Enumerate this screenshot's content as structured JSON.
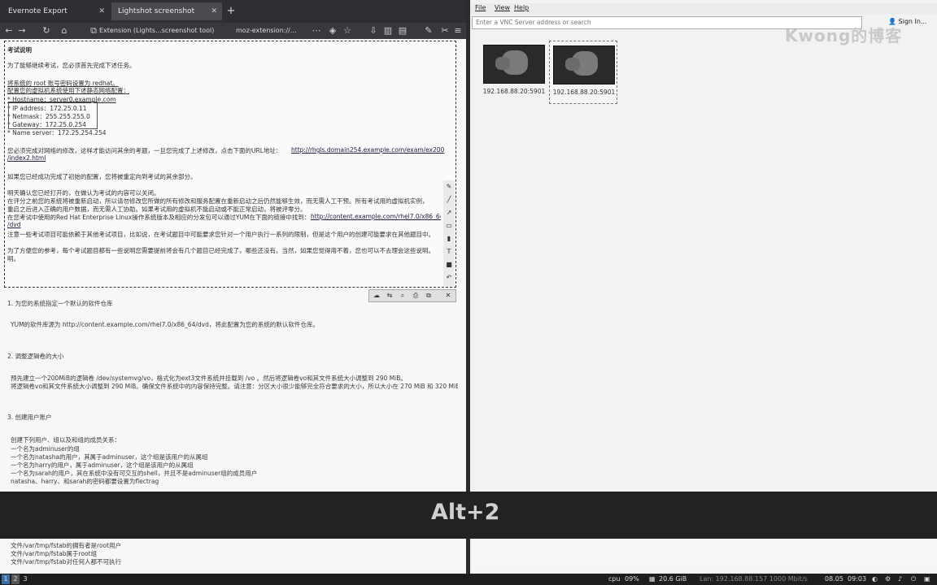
{
  "browser": {
    "tabs": [
      {
        "label": "Evernote Export",
        "active": false
      },
      {
        "label": "Lightshot screenshot",
        "active": true
      }
    ],
    "toolbar": {
      "extension_url": "Extension (Lights...screenshot tool)",
      "moz_url": "moz-extension://..."
    }
  },
  "screenshot": {
    "lines": [
      "考试说明",
      "为了能够继续考试，您必须首先完成下述任务。",
      "将系统的 root 账号密码设置为 redhat。",
      "配置您的虚拟机系统使用下述静态网络配置：",
      "* Hostname：server0.example.com",
      "* IP address：172.25.0.11",
      "* Netmask：255.255.255.0",
      "* Gateway：172.25.0.254",
      "* Name server：172.25.254.254",
      "您必须完成对网络的修改，这样才能访问其余的考题，一旦您完成了上述修改，点击下面的URL地址：",
      "http://rhgls.domain254.example.com/exam/ex200",
      "/index2.html",
      "如果您已经成功完成了初始的配置，您将被重定向到考试的其余部分。",
      "明天确认您已经打开的，在做认为考试的内容可以关闭。",
      "在评分之前您的系统将被重新启动，所以请勿修改您所做的所有修改和服务配置在重新启动之后仍然能够生效，而无需人工干预。所有考试用的虚拟机实例，",
      "重启之后进入正确的用户数据，而无需人工协助。如果考试用的虚拟机不能启动或不能正常启动，将被评零分。",
      "在您考试中使用的Red Hat Enterprise Linux操作系统版本及相应的分发包可以通过YUM在下面的链接中找到：",
      "http://content.example.com/rhel7.0/x86_64",
      "/dvd",
      "注意一些考试项目可能依赖于其他考试项目，比如说，在考试题目中可能要求您针对一个用户执行一系列的限制，但是这个用户的创建可能要求在其他题目中。",
      "为了方便您的参考，每个考试题目都有一些说明您需要提前将会有几个题目已经完成了，哪些还没有。当然，如果您觉得用不着，您也可以不去理会这些说明。",
      "明。"
    ]
  },
  "below": {
    "items": [
      "1.  为您的系统指定一个默认的软件仓库",
      "YUM的软件库源为 http://content.example.com/rhel7.0/x86_64/dvd，将此配置为您的系统的默认软件仓库。",
      "2.  调整逻辑卷的大小",
      "将逻辑卷vo和其文件系统大小调整到 290 MiB。确保文件系统中的内容保持完整。请注意：分区大小很少能够完全符合要求的大小，所以大小在 270 MiB 和 320 MiB 之间都是可以接受的。",
      "预先建立一个200MiB的逻辑卷 /dev/systemvg/vo，格式化为ext3文件系统并挂载到 /vo 。然后将逻辑卷vo和其文件系统大小调整到 290 MiB。",
      "3.  创建用户账户",
      "创建下列用户、组以及和组的成员关系：",
      "一个名为adminuser的组",
      "一个名为natasha的用户，其属于adminuser，这个组是该用户的从属组",
      "一个名为harry的用户，属于adminuser，这个组是该用户的从属组",
      "一个名为sarah的用户，其在系统中没有可交互的shell，并且不是adminuser组的成员用户",
      "natasha、harry、和sarah的密码都要设置为flectrag",
      "文件/var/tmp/fstab的拥有者是root用户",
      "文件/var/tmp/fstab属于root组",
      "文件/var/tmp/fstab对任何人都不可执行"
    ]
  },
  "keyhint": "Alt+2",
  "vnc": {
    "menu": [
      "File",
      "View",
      "Help"
    ],
    "search_placeholder": "Enter a VNC Server address or search",
    "signin": "Sign In...",
    "watermark": "Kwong的博客",
    "servers": [
      "192.168.88.20:5901",
      "192.168.88.20:5901"
    ]
  },
  "taskbar": {
    "workspaces": [
      "1",
      "2",
      "3"
    ],
    "cpu": "cpu",
    "cpu_val": "09%",
    "mem": "20.6 GiB",
    "net": "Lan: 192.168.88.157 1000 Mbit/s",
    "date": "08.05",
    "time": "09:03"
  }
}
